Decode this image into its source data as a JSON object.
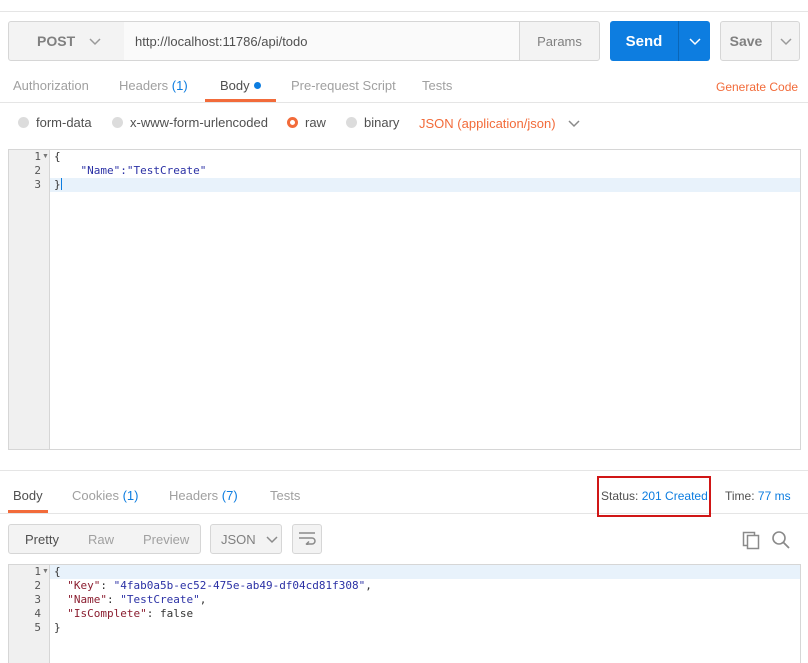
{
  "request": {
    "method": "POST",
    "url": "http://localhost:11786/api/todo",
    "params_label": "Params",
    "send_label": "Send",
    "save_label": "Save"
  },
  "request_tabs": [
    {
      "label": "Authorization",
      "count": ""
    },
    {
      "label": "Headers",
      "count": "(1)"
    },
    {
      "label": "Body",
      "count": ""
    },
    {
      "label": "Pre-request Script",
      "count": ""
    },
    {
      "label": "Tests",
      "count": ""
    }
  ],
  "generate_code_label": "Generate Code",
  "body_types": [
    "form-data",
    "x-www-form-urlencoded",
    "raw",
    "binary"
  ],
  "content_type": "JSON (application/json)",
  "request_body": {
    "line_numbers": [
      "1",
      "2",
      "3"
    ],
    "lines": [
      "{",
      "    \"Name\":\"TestCreate\"",
      "}"
    ]
  },
  "response_tabs": [
    {
      "label": "Body",
      "count": ""
    },
    {
      "label": "Cookies",
      "count": "(1)"
    },
    {
      "label": "Headers",
      "count": "(7)"
    },
    {
      "label": "Tests",
      "count": ""
    }
  ],
  "status": {
    "label": "Status:",
    "value": "201 Created"
  },
  "time": {
    "label": "Time:",
    "value": "77 ms"
  },
  "view_modes": [
    "Pretty",
    "Raw",
    "Preview"
  ],
  "format": "JSON",
  "response_body": {
    "line_numbers": [
      "1",
      "2",
      "3",
      "4",
      "5"
    ],
    "key_1": "\"Key\"",
    "val_1": "\"4fab0a5b-ec52-475e-ab49-df04cd81f308\"",
    "key_2": "\"Name\"",
    "val_2": "\"TestCreate\"",
    "key_3": "\"IsComplete\"",
    "val_3": "false",
    "open": "{",
    "close": "}"
  },
  "colors": {
    "accent_orange": "#f26b3a",
    "accent_blue": "#0d7de0",
    "status_highlight": "#d01616"
  }
}
